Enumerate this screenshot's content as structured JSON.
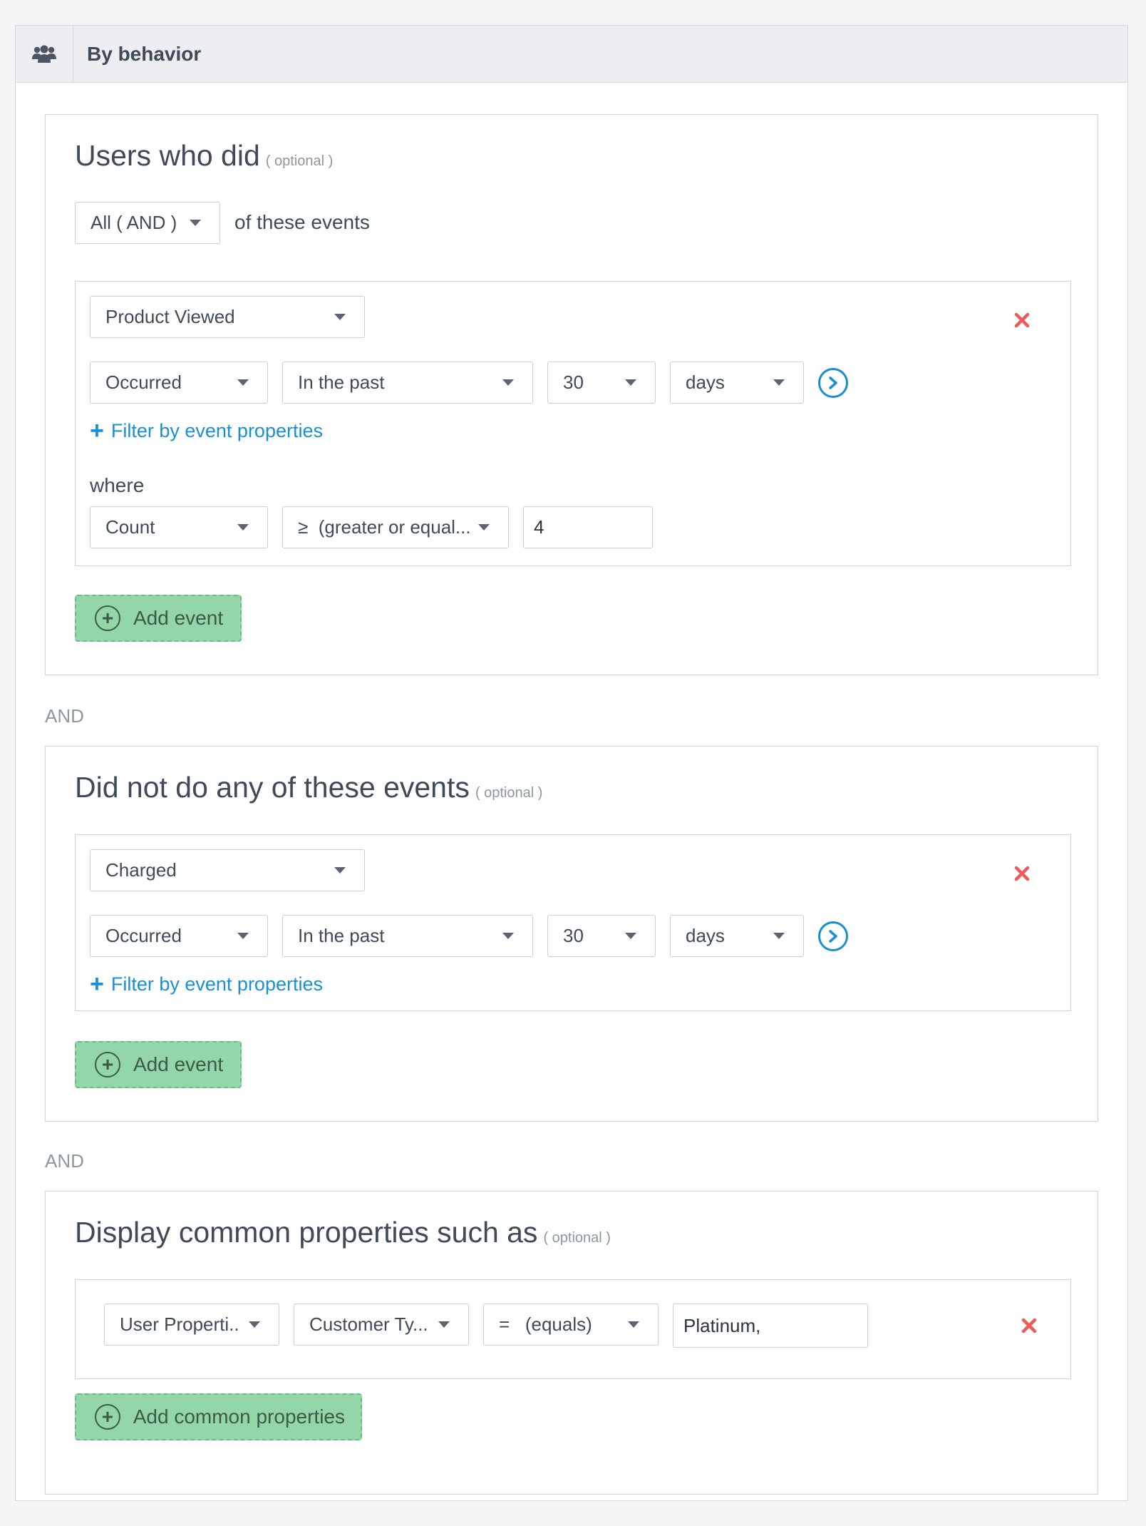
{
  "header": {
    "title": "By behavior",
    "icon": "users-icon"
  },
  "optional_label": "( optional )",
  "and_label": "AND",
  "colors": {
    "accent": "#1a8fd1",
    "remove": "#ee5b5b",
    "add_button": "#93d6a9"
  },
  "did_section": {
    "title": "Users who did",
    "match_select": "All ( AND )",
    "match_suffix": "of these events",
    "event": {
      "name": "Product Viewed",
      "occurrence": "Occurred",
      "time_range": "In the past",
      "amount": "30",
      "unit": "days",
      "filter_link": "Filter by event properties",
      "where_label": "where",
      "where_field": "Count",
      "where_operator": "≥  (greater or equal...",
      "where_value": "4"
    },
    "add_button": "Add event"
  },
  "did_not_section": {
    "title": "Did not do any of these events",
    "event": {
      "name": "Charged",
      "occurrence": "Occurred",
      "time_range": "In the past",
      "amount": "30",
      "unit": "days",
      "filter_link": "Filter by event properties"
    },
    "add_button": "Add event"
  },
  "common_section": {
    "title": "Display common properties such as",
    "property": {
      "source": "User Properti...",
      "field": "Customer Ty...",
      "operator": "=   (equals)",
      "value": "Platinum,"
    },
    "add_button": "Add common properties"
  }
}
